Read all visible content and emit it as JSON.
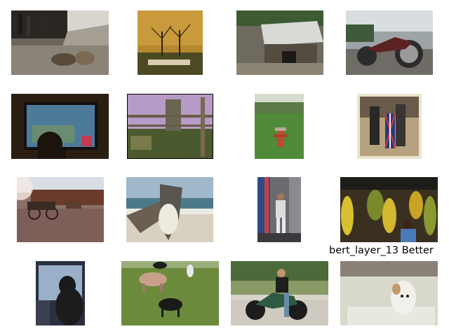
{
  "figure": {
    "caption": "bert_layer_13 Better"
  },
  "images": [
    {
      "subject": "teddy bears on sidewalk"
    },
    {
      "subject": "sheep under trees painting"
    },
    {
      "subject": "stone shelter with tarp"
    },
    {
      "subject": "chopper motorcycle"
    },
    {
      "subject": "person watching tv screen"
    },
    {
      "subject": "fenced garden with tower"
    },
    {
      "subject": "fire hydrant on lawn"
    },
    {
      "subject": "people with union jack surfboard"
    },
    {
      "subject": "horse carriage on street"
    },
    {
      "subject": "pelican on beach"
    },
    {
      "subject": "man playing wii in room"
    },
    {
      "subject": "banana market stall"
    },
    {
      "subject": "dog in car window"
    },
    {
      "subject": "cows in pasture"
    },
    {
      "subject": "man on motorcycle"
    },
    {
      "subject": "dog in bathtub"
    }
  ]
}
